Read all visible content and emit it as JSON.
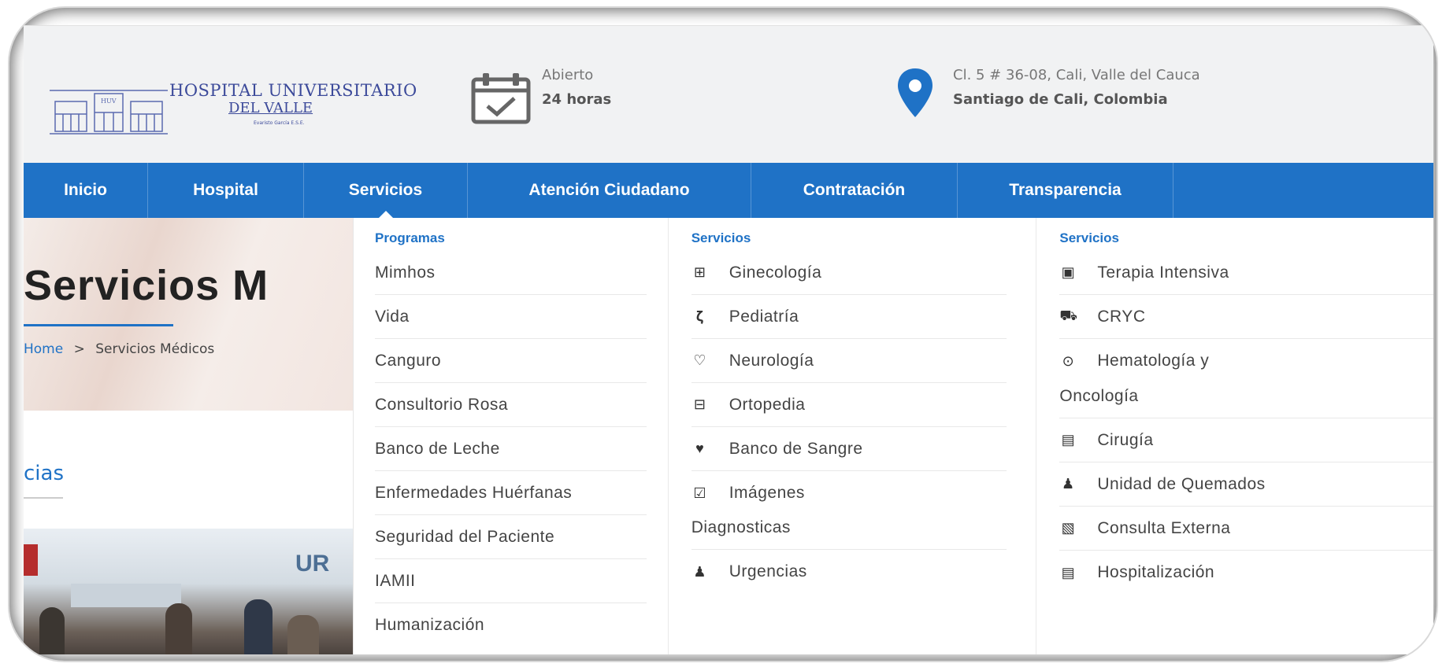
{
  "header": {
    "logo_title": "HOSPITAL UNIVERSITARIO",
    "logo_subtitle": "DEL VALLE",
    "logo_tagline": "Evaristo García E.S.E.",
    "logo_badge": "HUV",
    "hours": {
      "line1": "Abierto",
      "line2": "24 horas",
      "icon": "calendar-check-icon"
    },
    "address": {
      "line1": "Cl. 5 # 36-08, Cali, Valle del Cauca",
      "line2": "Santiago de Cali, Colombia",
      "icon": "map-pin-icon"
    }
  },
  "nav": {
    "items": [
      {
        "label": "Inicio"
      },
      {
        "label": "Hospital"
      },
      {
        "label": "Servicios",
        "active": true
      },
      {
        "label": "Atención Ciudadano"
      },
      {
        "label": "Contratación"
      },
      {
        "label": "Transparencia"
      }
    ]
  },
  "page": {
    "title": "Servicios M",
    "breadcrumb_home": "Home",
    "breadcrumb_sep": ">",
    "breadcrumb_current": "Servicios Médicos",
    "section_title": "cias",
    "photo_sign": "UR"
  },
  "mega": {
    "col1": {
      "heading": "Programas",
      "items": [
        "Mimhos",
        "Vida",
        "Canguro",
        "Consultorio Rosa",
        "Banco de Leche",
        "Enfermedades Huérfanas",
        "Seguridad del Paciente",
        "IAMII",
        "Humanización"
      ]
    },
    "col2": {
      "heading": "Servicios",
      "items": [
        {
          "label": "Ginecología",
          "icon": "plus-square-icon"
        },
        {
          "label": "Pediatría",
          "icon": "stethoscope-icon"
        },
        {
          "label": "Neurología",
          "icon": "heart-outline-icon"
        },
        {
          "label": "Ortopedia",
          "icon": "minus-square-icon"
        },
        {
          "label": "Banco de Sangre",
          "icon": "heart-pulse-icon"
        },
        {
          "label": "Imágenes",
          "icon": "check-square-icon"
        },
        {
          "label": "Diagnosticas"
        },
        {
          "label": "Urgencias",
          "icon": "user-doctor-icon"
        }
      ]
    },
    "col3": {
      "heading": "Servicios",
      "items": [
        {
          "label": "Terapia Intensiva",
          "icon": "medkit-icon"
        },
        {
          "label": "CRYC",
          "icon": "ambulance-icon"
        },
        {
          "label": "Hematología y",
          "icon": "dot-circle-icon"
        },
        {
          "label": "Oncología"
        },
        {
          "label": "Cirugía",
          "icon": "hospital-icon"
        },
        {
          "label": "Unidad de Quemados",
          "icon": "user-doctor-icon"
        },
        {
          "label": "Consulta Externa",
          "icon": "h-square-icon"
        },
        {
          "label": "Hospitalización",
          "icon": "hospital-icon"
        }
      ]
    }
  }
}
